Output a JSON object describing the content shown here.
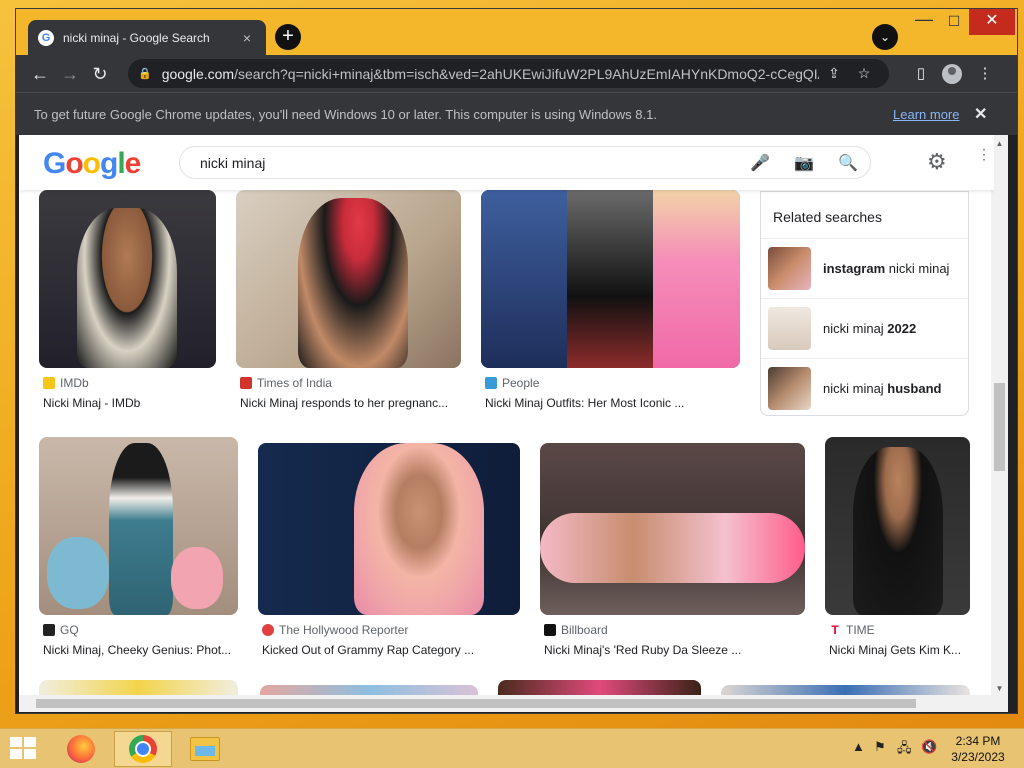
{
  "browser": {
    "tab_title": "nicki minaj - Google Search",
    "tab_close": "×",
    "new_tab": "+",
    "tab_search": "⌄",
    "url_host": "google.com",
    "url_path": "/search?q=nicki+minaj&tbm=isch&ved=2ahUKEwiJifuW2PL9AhUzEmIAHYnKDmoQ2-cCegQIA...",
    "window_controls": {
      "minimize": "—",
      "maximize": "☐",
      "close": "✕"
    }
  },
  "infobar": {
    "message": "To get future Google Chrome updates, you'll need Windows 10 or later. This computer is using Windows 8.1.",
    "link": "Learn more",
    "close": "✕"
  },
  "google": {
    "logo_letters": [
      "G",
      "o",
      "o",
      "g",
      "l",
      "e"
    ],
    "query": "nicki minaj"
  },
  "related": {
    "heading": "Related searches",
    "items": [
      {
        "bold": "instagram",
        "rest": " nicki minaj",
        "bold_first": true
      },
      {
        "bold": "2022",
        "rest": "nicki minaj ",
        "bold_first": false
      },
      {
        "bold": "husband",
        "rest": "nicki minaj ",
        "bold_first": false
      }
    ]
  },
  "results": [
    {
      "source": "IMDb",
      "caption": "Nicki Minaj - IMDb",
      "fav_color": "#f5c518"
    },
    {
      "source": "Times of India",
      "caption": "Nicki Minaj responds to her pregnanc...",
      "fav_color": "#d0342c"
    },
    {
      "source": "People",
      "caption": "Nicki Minaj Outfits: Her Most Iconic ...",
      "fav_color": "#3a9ad9"
    },
    {
      "source": "GQ",
      "caption": "Nicki Minaj, Cheeky Genius: Phot...",
      "fav_color": "#222222"
    },
    {
      "source": "The Hollywood Reporter",
      "caption": "Kicked Out of Grammy Rap Category ...",
      "fav_color": "#e04040"
    },
    {
      "source": "Billboard",
      "caption": "Nicki Minaj's 'Red Ruby Da Sleeze ...",
      "fav_color": "#111111"
    },
    {
      "source": "TIME",
      "caption": "Nicki Minaj Gets Kim K...",
      "fav_color": "#e4002b"
    }
  ],
  "taskbar": {
    "time": "2:34 PM",
    "date": "3/23/2023"
  }
}
